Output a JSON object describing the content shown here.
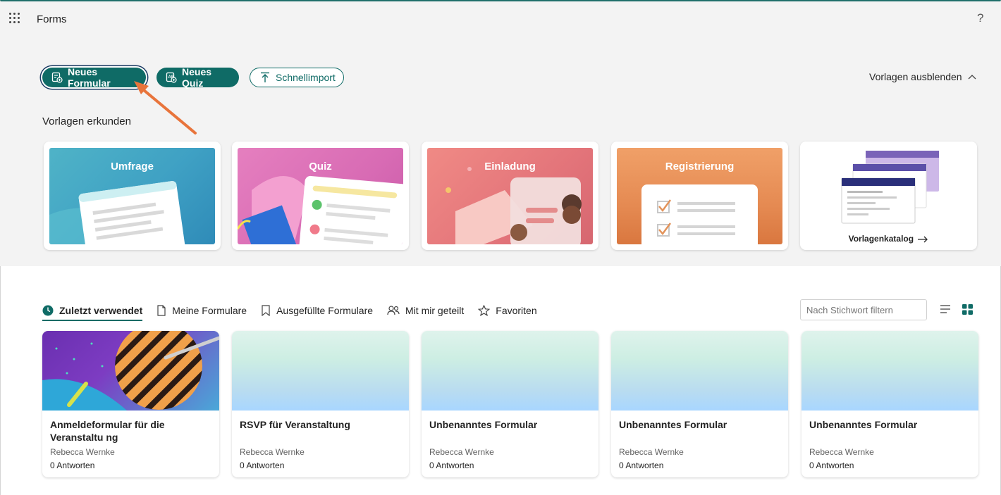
{
  "app": {
    "title": "Forms",
    "help": "?"
  },
  "toolbar": {
    "new_form": "Neues Formular",
    "new_quiz": "Neues Quiz",
    "quick_import": "Schnellimport",
    "hide_templates": "Vorlagen ausblenden"
  },
  "templates": {
    "heading": "Vorlagen erkunden",
    "items": [
      {
        "label": "Umfrage"
      },
      {
        "label": "Quiz"
      },
      {
        "label": "Einladung"
      },
      {
        "label": "Registrierung"
      },
      {
        "label": "Vorlagenkatalog"
      }
    ]
  },
  "tabs": [
    {
      "label": "Zuletzt verwendet",
      "icon": "clock-icon",
      "active": true
    },
    {
      "label": "Meine Formulare",
      "icon": "document-icon"
    },
    {
      "label": "Ausgefüllte Formulare",
      "icon": "bookmark-icon"
    },
    {
      "label": "Mit mir geteilt",
      "icon": "people-icon"
    },
    {
      "label": "Favoriten",
      "icon": "star-icon"
    }
  ],
  "filter": {
    "placeholder": "Nach Stichwort filtern"
  },
  "forms": [
    {
      "title": "Anmeldeformular für die Veranstaltu ng",
      "owner": "Rebecca Wernke",
      "responses": "0 Antworten"
    },
    {
      "title": "RSVP für Veranstaltung",
      "owner": "Rebecca Wernke",
      "responses": "0 Antworten"
    },
    {
      "title": "Unbenanntes Formular",
      "owner": "Rebecca Wernke",
      "responses": "0 Antworten"
    },
    {
      "title": "Unbenanntes Formular",
      "owner": "Rebecca Wernke",
      "responses": "0 Antworten"
    },
    {
      "title": "Unbenanntes Formular",
      "owner": "Rebecca Wernke",
      "responses": "0 Antworten"
    }
  ],
  "colors": {
    "accent": "#0f6b66",
    "annotation_arrow": "#e8743b",
    "upper_bg": "#f3f3f3"
  }
}
